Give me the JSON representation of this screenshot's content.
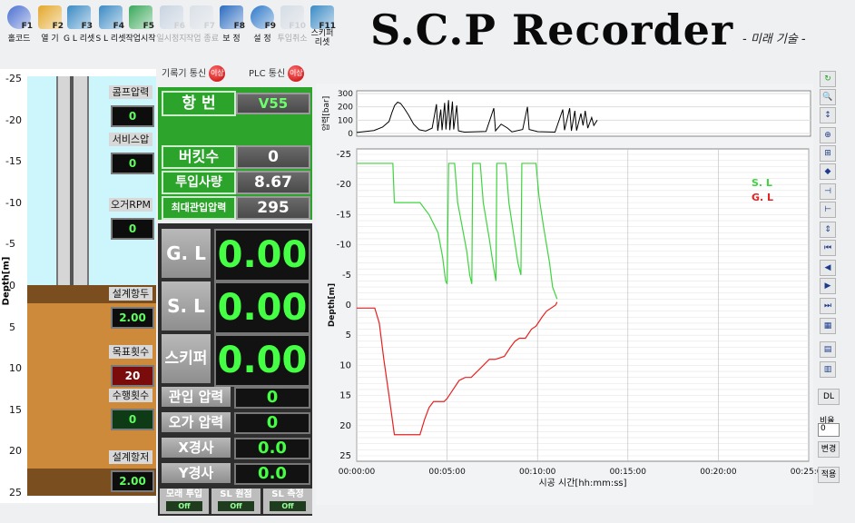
{
  "toolbar": [
    {
      "key": "F1",
      "label": "홀코드",
      "icon": "target-icon",
      "enabled": true
    },
    {
      "key": "F2",
      "label": "열 기",
      "icon": "folder-icon",
      "enabled": true
    },
    {
      "key": "F3",
      "label": "G L 리셋",
      "icon": "reset-icon",
      "enabled": true
    },
    {
      "key": "F4",
      "label": "S L 리셋",
      "icon": "reset-icon",
      "enabled": true
    },
    {
      "key": "F5",
      "label": "작업시작",
      "icon": "start-icon",
      "enabled": true
    },
    {
      "key": "F6",
      "label": "일시정지",
      "icon": "pause-icon",
      "enabled": false
    },
    {
      "key": "F7",
      "label": "작업 종료",
      "icon": "stop-icon",
      "enabled": false
    },
    {
      "key": "F8",
      "label": "보 정",
      "icon": "calibrate-icon",
      "enabled": true
    },
    {
      "key": "F9",
      "label": "설 정",
      "icon": "gear-icon",
      "enabled": true
    },
    {
      "key": "F10",
      "label": "투입취소",
      "icon": "cancel-icon",
      "enabled": false
    },
    {
      "key": "F11",
      "label": "스키퍼 리셋",
      "icon": "reset-icon",
      "enabled": true
    }
  ],
  "brand": {
    "title": "S.C.P Recorder",
    "subtitle": "- 미래 기술 -"
  },
  "depth_panel": {
    "ylabel": "Depth[m]",
    "ticks": [
      "-25",
      "-20",
      "-15",
      "-10",
      "-5",
      "0",
      "5",
      "10",
      "15",
      "20",
      "25"
    ],
    "gauges": [
      {
        "label": "콤프압력",
        "value": "0",
        "color": "#5dff5d"
      },
      {
        "label": "서비스압",
        "value": "0",
        "color": "#5dff5d"
      },
      {
        "label": "오거RPM",
        "value": "0",
        "color": "#5dff5d"
      },
      {
        "label": "설계항두",
        "value": "2.00",
        "color": "#5dff5d"
      },
      {
        "label": "목표횟수",
        "value": "20",
        "color": "#ffffff"
      },
      {
        "label": "수행횟수",
        "value": "0",
        "color": "#5dff5d"
      },
      {
        "label": "설계항저",
        "value": "2.00",
        "color": "#5dff5d"
      }
    ]
  },
  "comm": {
    "recorder": "기록기 통신",
    "plc": "PLC 통신",
    "led": "이상"
  },
  "summary": [
    {
      "label": "항 번",
      "value": "V55"
    },
    {
      "label": "버킷수",
      "value": "0"
    },
    {
      "label": "투입사량",
      "value": "8.67"
    },
    {
      "label": "최대관입압력",
      "value": "295"
    }
  ],
  "levels": [
    {
      "label": "G. L",
      "value": "0.00"
    },
    {
      "label": "S. L",
      "value": "0.00"
    },
    {
      "label": "스키퍼",
      "value": "0.00"
    }
  ],
  "readouts": [
    {
      "label": "관입 압력",
      "value": "0"
    },
    {
      "label": "오가 압력",
      "value": "0"
    },
    {
      "label": "X경사",
      "value": "0.0"
    },
    {
      "label": "Y경사",
      "value": "0.0"
    }
  ],
  "switches": [
    {
      "label": "모래 투입",
      "state": "Off"
    },
    {
      "label": "SL 원점",
      "state": "Off"
    },
    {
      "label": "SL 측정",
      "state": "Off"
    }
  ],
  "side": {
    "dl": "DL",
    "ratio_label": "비율",
    "ratio_value": "0",
    "change": "변경",
    "apply": "적용"
  },
  "chart_data": [
    {
      "type": "line",
      "ylabel": "압력[bar]",
      "y_ticks": [
        "300",
        "200",
        "100",
        "0"
      ],
      "ylim": [
        0,
        300
      ],
      "series": [
        {
          "name": "",
          "color": "#000000",
          "points": [
            [
              0,
              8
            ],
            [
              40,
              22
            ],
            [
              60,
              48
            ],
            [
              75,
              90
            ],
            [
              82,
              160
            ],
            [
              88,
              210
            ],
            [
              95,
              235
            ],
            [
              102,
              225
            ],
            [
              110,
              190
            ],
            [
              120,
              140
            ],
            [
              132,
              70
            ],
            [
              145,
              28
            ],
            [
              160,
              18
            ],
            [
              175,
              40
            ],
            [
              185,
              220
            ],
            [
              188,
              20
            ],
            [
              195,
              180
            ],
            [
              198,
              25
            ],
            [
              204,
              230
            ],
            [
              207,
              30
            ],
            [
              213,
              250
            ],
            [
              216,
              25
            ],
            [
              222,
              240
            ],
            [
              225,
              30
            ],
            [
              232,
              210
            ],
            [
              236,
              20
            ],
            [
              250,
              10
            ],
            [
              300,
              15
            ],
            [
              318,
              190
            ],
            [
              322,
              20
            ],
            [
              335,
              70
            ],
            [
              350,
              40
            ],
            [
              360,
              12
            ],
            [
              385,
              30
            ],
            [
              396,
              200
            ],
            [
              400,
              30
            ],
            [
              420,
              14
            ],
            [
              460,
              10
            ],
            [
              478,
              180
            ],
            [
              482,
              25
            ],
            [
              494,
              190
            ],
            [
              498,
              20
            ],
            [
              506,
              170
            ],
            [
              510,
              22
            ],
            [
              520,
              150
            ],
            [
              525,
              60
            ],
            [
              530,
              170
            ],
            [
              536,
              40
            ],
            [
              545,
              120
            ],
            [
              550,
              60
            ],
            [
              558,
              100
            ]
          ]
        }
      ]
    },
    {
      "type": "line",
      "xlabel": "시공 시간[hh:mm:ss]",
      "ylabel": "Depth[m]",
      "x_ticks": [
        "00:00:00",
        "00:05:00",
        "00:10:00",
        "00:15:00",
        "00:20:00",
        "00:25:00"
      ],
      "y_ticks": [
        "-25",
        "-20",
        "-15",
        "-10",
        "-5",
        "0",
        "5",
        "10",
        "15",
        "20",
        "25"
      ],
      "xlim": [
        0,
        1500
      ],
      "ylim": [
        -25,
        25
      ],
      "legend": "top-right",
      "series": [
        {
          "name": "S. L",
          "color": "#3fd43f",
          "points": [
            [
              0,
              -23.5
            ],
            [
              120,
              -23.5
            ],
            [
              125,
              -17
            ],
            [
              210,
              -17
            ],
            [
              240,
              -15
            ],
            [
              270,
              -12
            ],
            [
              285,
              -8
            ],
            [
              295,
              -4
            ],
            [
              300,
              -3.5
            ],
            [
              305,
              -23.5
            ],
            [
              325,
              -23.5
            ],
            [
              335,
              -17
            ],
            [
              350,
              -13
            ],
            [
              365,
              -9
            ],
            [
              375,
              -5
            ],
            [
              382,
              -3.5
            ],
            [
              385,
              -23.5
            ],
            [
              410,
              -23.5
            ],
            [
              420,
              -17
            ],
            [
              440,
              -11
            ],
            [
              455,
              -6
            ],
            [
              462,
              -4
            ],
            [
              465,
              -23.5
            ],
            [
              495,
              -23.5
            ],
            [
              505,
              -17
            ],
            [
              520,
              -12
            ],
            [
              535,
              -7
            ],
            [
              545,
              -5
            ],
            [
              548,
              -23.5
            ],
            [
              595,
              -23.5
            ],
            [
              605,
              -18
            ],
            [
              620,
              -13
            ],
            [
              640,
              -7
            ],
            [
              650,
              -3
            ],
            [
              665,
              -1
            ]
          ]
        },
        {
          "name": "G. L",
          "color": "#e82020",
          "points": [
            [
              0,
              0.5
            ],
            [
              60,
              0.5
            ],
            [
              75,
              3
            ],
            [
              90,
              9
            ],
            [
              110,
              16
            ],
            [
              125,
              21.5
            ],
            [
              160,
              21.5
            ],
            [
              210,
              21.5
            ],
            [
              225,
              19
            ],
            [
              240,
              17
            ],
            [
              255,
              16
            ],
            [
              290,
              16
            ],
            [
              300,
              15.5
            ],
            [
              320,
              14
            ],
            [
              340,
              12.5
            ],
            [
              360,
              12
            ],
            [
              380,
              12
            ],
            [
              400,
              11
            ],
            [
              420,
              10
            ],
            [
              440,
              9
            ],
            [
              460,
              9
            ],
            [
              490,
              8.5
            ],
            [
              510,
              7
            ],
            [
              525,
              6
            ],
            [
              540,
              5.5
            ],
            [
              560,
              5.5
            ],
            [
              580,
              4
            ],
            [
              595,
              3.5
            ],
            [
              615,
              2
            ],
            [
              630,
              1
            ],
            [
              660,
              0
            ],
            [
              665,
              -0.5
            ]
          ]
        }
      ]
    }
  ]
}
